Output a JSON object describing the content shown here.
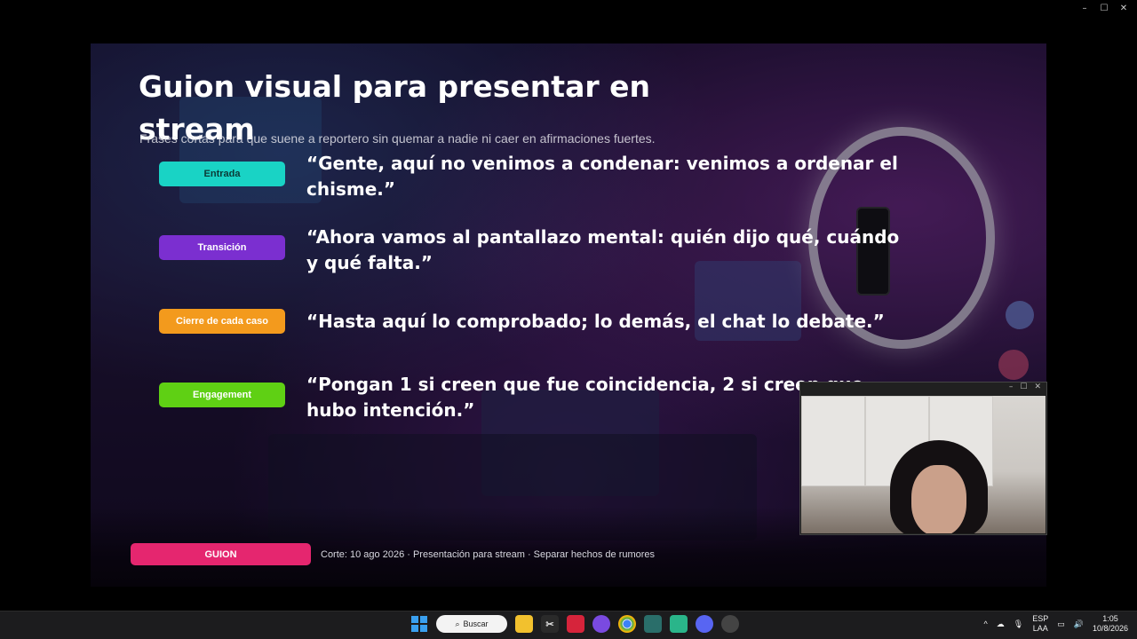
{
  "window": {
    "minimize": "–",
    "maximize": "☐",
    "close": "✕"
  },
  "slide": {
    "title": "Guion visual para presentar en stream",
    "subtitle": "Frases cortas para que suene a reportero sin quemar a nadie ni caer en afirmaciones fuertes.",
    "rows": [
      {
        "label": "Entrada",
        "color": "#19d3c5",
        "text_color": "#0b3a36",
        "quote": "“Gente, aquí no venimos a condenar: venimos a ordenar el chisme.”"
      },
      {
        "label": "Transición",
        "color": "#7b2fd0",
        "text_color": "#ffffff",
        "quote": "“Ahora vamos al pantallazo mental: quién dijo qué, cuándo y qué falta.”"
      },
      {
        "label": "Cierre de cada caso",
        "color": "#f39a1d",
        "text_color": "#ffffff",
        "quote": "“Hasta aquí lo comprobado; lo demás, el chat lo debate.”"
      },
      {
        "label": "Engagement",
        "color": "#5fd014",
        "text_color": "#ffffff",
        "quote": "“Pongan 1 si creen que fue coincidencia, 2 si creen que hubo intención.”"
      }
    ],
    "footer": {
      "pill": "GUION",
      "pill_color": "#e5266f",
      "text": "Corte: 10 ago 2026 · Presentación para stream · Separar hechos de rumores"
    }
  },
  "camera": {
    "minimize": "–",
    "maximize": "☐",
    "close": "✕"
  },
  "taskbar": {
    "search_label": "Buscar",
    "tray": {
      "language_top": "ESP",
      "language_bottom": "LAA",
      "time": "1:05",
      "date": "10/8/2026"
    }
  }
}
